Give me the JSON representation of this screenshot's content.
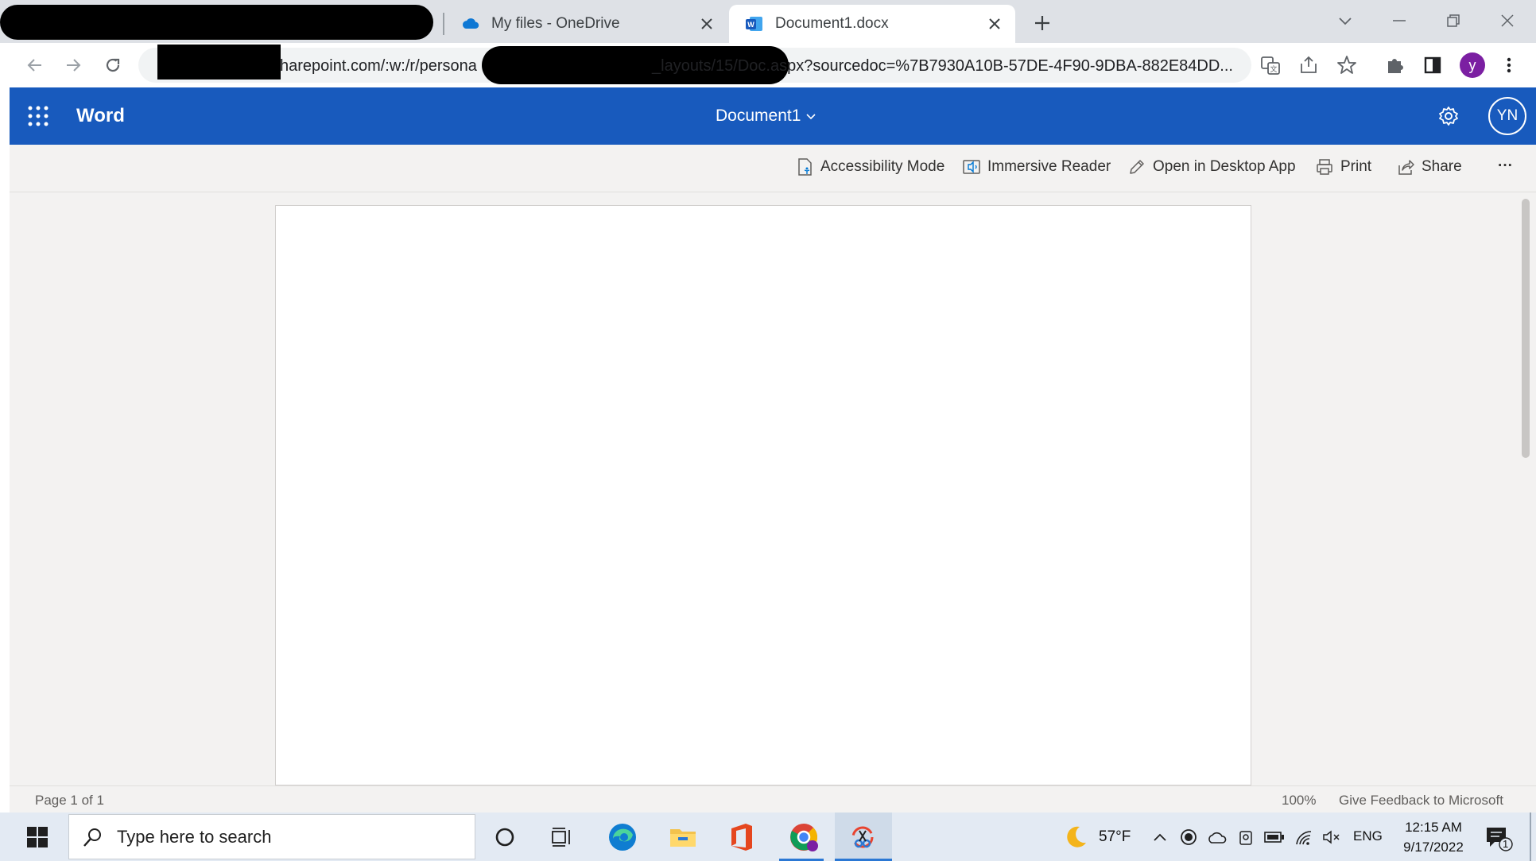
{
  "browser": {
    "tabs": [
      {
        "title": "My files - OneDrive",
        "icon": "onedrive-cloud-icon"
      },
      {
        "title": "Document1.docx",
        "icon": "word-icon",
        "active": true
      }
    ],
    "address_bar": {
      "url_part1": "harepoint.com/:w:/r/persona",
      "url_part2": "_layouts/15/Doc.aspx?sourcedoc=%7B7930A10B-57DE-4F90-9DBA-882E84DD..."
    },
    "profile_initial": "y",
    "profile_color": "#7b1fa2"
  },
  "word": {
    "app_name": "Word",
    "doc_title": "Document1",
    "user_initials": "YN",
    "brand_color": "#185abd",
    "commands": {
      "accessibility": "Accessibility Mode",
      "immersive": "Immersive Reader",
      "desktop": "Open in Desktop App",
      "print": "Print",
      "share": "Share",
      "more": "···"
    },
    "status": {
      "page": "Page 1 of 1",
      "zoom": "100%",
      "feedback": "Give Feedback to Microsoft"
    }
  },
  "taskbar": {
    "search_placeholder": "Type here to search",
    "weather": "57°F",
    "language": "ENG",
    "time": "12:15 AM",
    "date": "9/17/2022",
    "notifications": "1"
  }
}
